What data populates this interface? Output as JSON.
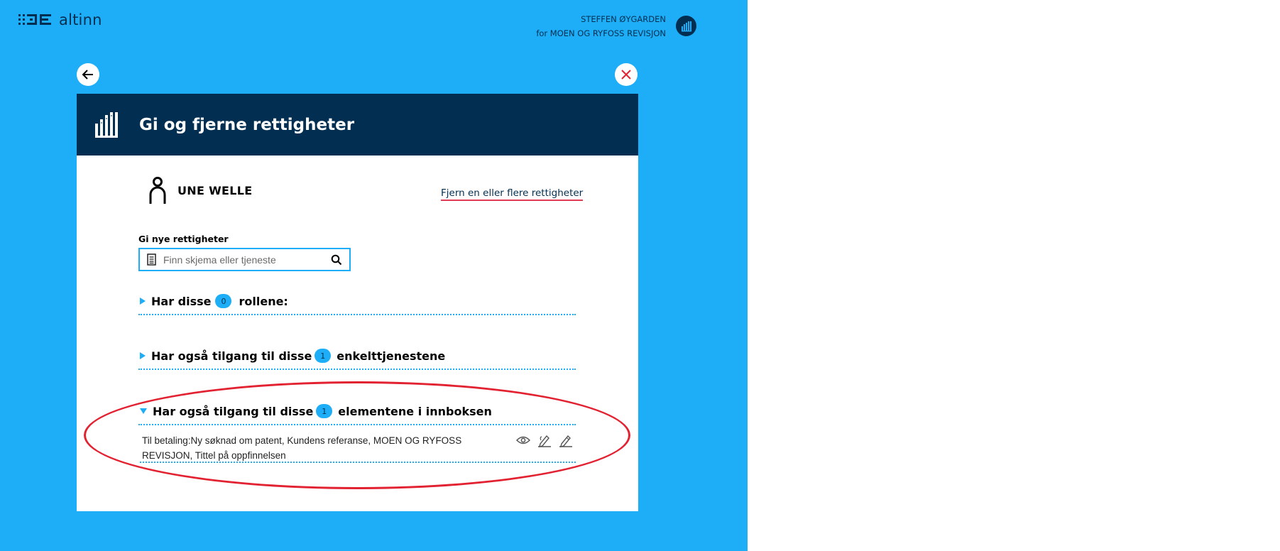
{
  "brand": {
    "name": "altinn"
  },
  "user": {
    "name": "STEFFEN ØYGARDEN",
    "org_line": "for MOEN OG RYFOSS REVISJON"
  },
  "modal": {
    "title": "Gi og fjerne rettigheter",
    "person_name": "UNE WELLE",
    "remove_link": "Fjern en eller flere rettigheter",
    "search_label": "Gi nye rettigheter",
    "search_placeholder": "Finn skjema eller tjeneste",
    "sections": [
      {
        "prefix": "Har disse",
        "count": "0",
        "suffix": "rollene:",
        "expanded": false
      },
      {
        "prefix": "Har også tilgang til disse",
        "count": "1",
        "suffix": "enkelttjenestene",
        "expanded": false
      },
      {
        "prefix": "Har også tilgang til disse",
        "count": "1",
        "suffix": "elementene i innboksen",
        "expanded": true
      }
    ],
    "inbox_item": {
      "text": "Til betaling:Ny søknad om patent, Kundens referanse, MOEN OG RYFOSS REVISJON, Tittel på oppfinnelsen",
      "icons": [
        "eye-icon",
        "sign-icon",
        "edit-icon"
      ]
    }
  },
  "colors": {
    "background": "#1eaef7",
    "header": "#022f51",
    "accent_red": "#e22131"
  }
}
